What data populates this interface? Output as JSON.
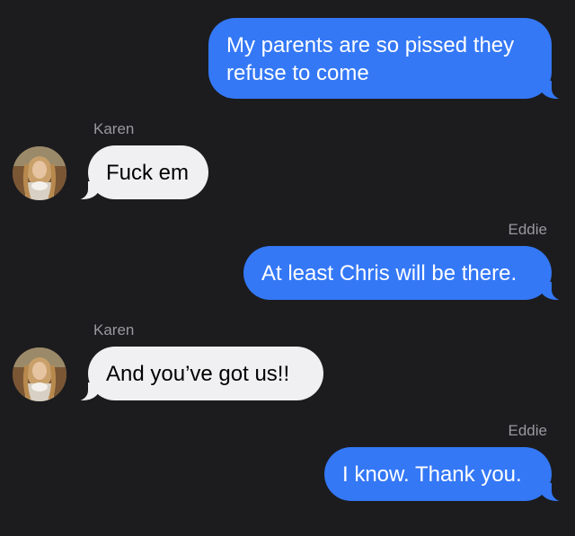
{
  "messages": [
    {
      "direction": "outgoing",
      "sender": "",
      "text": "My parents are so pissed they refuse to come"
    },
    {
      "direction": "incoming",
      "sender": "Karen",
      "text": "Fuck em"
    },
    {
      "direction": "outgoing",
      "sender": "Eddie",
      "text": "At least Chris will be there."
    },
    {
      "direction": "incoming",
      "sender": "Karen",
      "text": "And you’ve got us!!"
    },
    {
      "direction": "outgoing",
      "sender": "Eddie",
      "text": "I know. Thank you."
    }
  ],
  "colors": {
    "background": "#1c1c1e",
    "outgoing_bubble": "#3478f6",
    "incoming_bubble": "#f0f0f2",
    "sender_label": "#98989f"
  }
}
